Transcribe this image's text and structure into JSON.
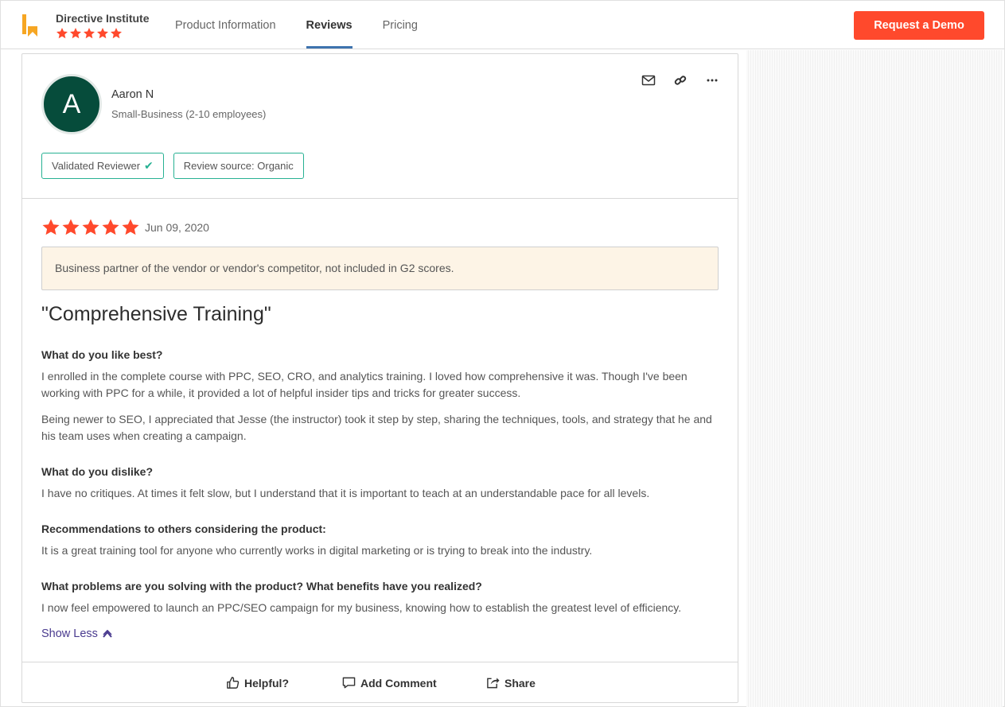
{
  "header": {
    "brand_name": "Directive Institute",
    "brand_rating_stars": 5,
    "tabs": [
      {
        "label": "Product Information",
        "active": false
      },
      {
        "label": "Reviews",
        "active": true
      },
      {
        "label": "Pricing",
        "active": false
      }
    ],
    "demo_button": "Request a Demo"
  },
  "colors": {
    "accent": "#ff492c",
    "star": "#ff492c",
    "badge_border": "#27b193",
    "avatar_bg": "#064c3b",
    "tab_underline": "#3e73ae",
    "link": "#4a3b8f",
    "notice_bg": "#fdf4e6"
  },
  "icons": {
    "logo": "g2-logo-icon",
    "actions": [
      "mail-icon",
      "link-icon",
      "more-icon"
    ],
    "helpful": "thumbs-up-icon",
    "comment": "comment-icon",
    "share": "share-icon",
    "show_less": "chevron-up-icon"
  },
  "review": {
    "avatar_letter": "A",
    "reviewer_name": "Aaron N",
    "reviewer_segment": "Small-Business (2-10 employees)",
    "badges": {
      "validated": "Validated Reviewer",
      "source": "Review source: Organic"
    },
    "rating_stars": 5,
    "date": "Jun 09, 2020",
    "notice": "Business partner of the vendor or vendor's competitor, not included in G2 scores.",
    "title": "\"Comprehensive Training\"",
    "qa": [
      {
        "question": "What do you like best?",
        "answers": [
          "I enrolled in the complete course with PPC, SEO, CRO, and analytics training. I loved how comprehensive it was. Though I've been working with PPC for a while, it provided a lot of helpful insider tips and tricks for greater success.",
          "Being newer to SEO, I appreciated that Jesse (the instructor) took it step by step, sharing the techniques, tools, and strategy that he and his team uses when creating a campaign."
        ]
      },
      {
        "question": "What do you dislike?",
        "answers": [
          "I have no critiques. At times it felt slow, but I understand that it is important to teach at an understandable pace for all levels."
        ]
      },
      {
        "question": "Recommendations to others considering the product:",
        "answers": [
          "It is a great training tool for anyone who currently works in digital marketing or is trying to break into the industry."
        ]
      },
      {
        "question": "What problems are you solving with the product? What benefits have you realized?",
        "answers": [
          "I now feel empowered to launch an PPC/SEO campaign for my business, knowing how to establish the greatest level of efficiency."
        ]
      }
    ],
    "show_less": "Show Less",
    "footer": {
      "helpful": "Helpful?",
      "comment": "Add Comment",
      "share": "Share"
    }
  }
}
